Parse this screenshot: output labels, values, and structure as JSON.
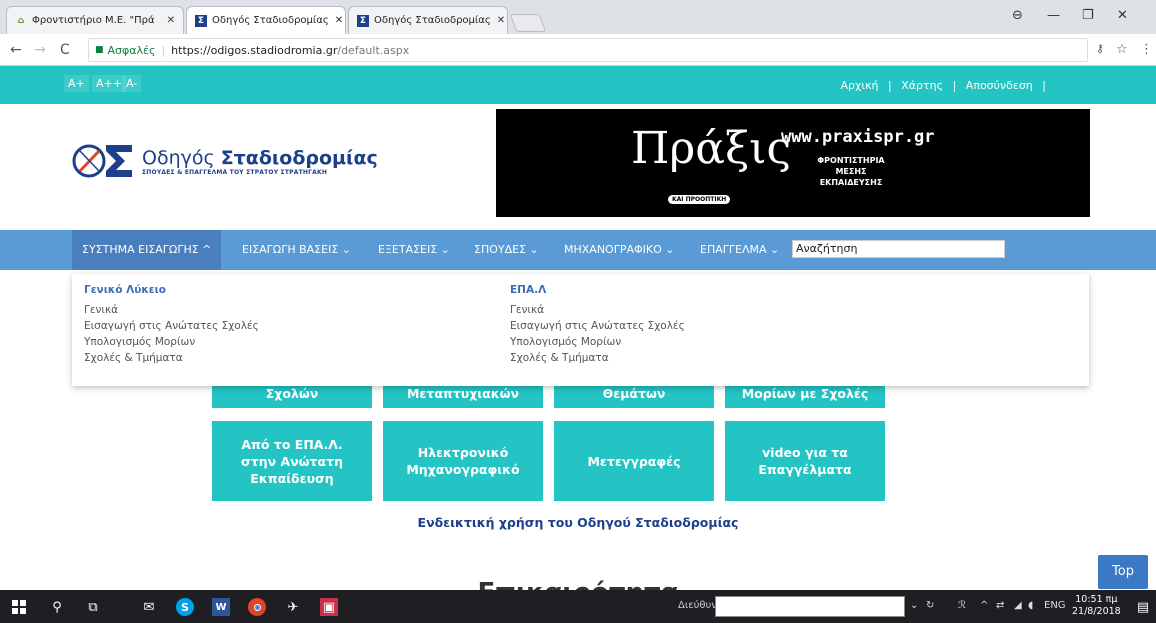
{
  "browser": {
    "tabs": [
      {
        "title": "Φροντιστήριο Μ.Ε. \"Πρά",
        "favicon": "house-icon",
        "active": false
      },
      {
        "title": "Οδηγός Σταδιοδρομίας",
        "favicon": "sigma-icon",
        "active": true
      },
      {
        "title": "Οδηγός Σταδιοδρομίας",
        "favicon": "sigma-icon",
        "active": false
      }
    ],
    "secure_label": "Ασφαλές",
    "url_host": "https://odigos.stadiodromia.gr",
    "url_path": "/default.aspx"
  },
  "site": {
    "font_sizes": [
      "A+",
      "A++",
      "A-"
    ],
    "top_links": [
      "Αρχική",
      "Χάρτης",
      "Αποσύνδεση"
    ],
    "logo_title_normal": "Οδηγός ",
    "logo_title_bold": "Σταδιοδρομίας",
    "logo_subtitle": "ΣΠΟΥΔΕΣ & ΕΠΑΓΓΕΛΜΑ ΤΟΥ ΣΤΡΑΤΟΥ ΣΤΡΑΤΗΓΑΚΗ",
    "banner": {
      "site": "www.praxispr.gr",
      "sub": [
        "ΦΡΟΝΤΙΣΤΗΡΙΑ",
        "ΜΕΣΗΣ",
        "ΕΚΠΑΙΔΕΥΣΗΣ"
      ],
      "pill": "ΚΑΙ ΠΡΟΟΠΤΙΚΗ"
    },
    "menu": [
      "ΣΥΣΤΗΜΑ ΕΙΣΑΓΩΓΗΣ ^",
      "ΕΙΣΑΓΩΓΗ ΒΑΣΕΙΣ ⌄",
      "ΕΞΕΤΑΣΕΙΣ ⌄",
      "ΣΠΟΥΔΕΣ ⌄",
      "ΜΗΧΑΝΟΓΡΑΦΙΚΟ ⌄",
      "ΕΠΑΓΓΕΛΜΑ ⌄"
    ],
    "search_value": "Αναζήτηση",
    "dropdown": {
      "col1": {
        "head": "Γενικό Λύκειο",
        "items": [
          "Γενικά",
          "Εισαγωγή στις Ανώτατες Σχολές",
          "Υπολογισμός Μορίων",
          "Σχολές & Τμήματα"
        ]
      },
      "col2": {
        "head": "ΕΠΑ.Λ",
        "items": [
          "Γενικά",
          "Εισαγωγή στις Ανώτατες Σχολές",
          "Υπολογισμός Μορίων",
          "Σχολές & Τμήματα"
        ]
      }
    },
    "tiles_row1": [
      "Σχολών",
      "Μεταπτυχιακών",
      "Θεμάτων",
      "Μορίων με Σχολές"
    ],
    "tiles_row2": [
      "Από το ΕΠΑ.Λ. στην Ανώτατη Εκπαίδευση",
      "Ηλεκτρονικό Μηχανογραφικό",
      "Μετεγγραφές",
      "video για τα Επαγγέλματα"
    ],
    "usage_link": "Ενδεικτική χρήση του Οδηγού Σταδιοδρομίας",
    "section_title": "Επικαιρότητα",
    "top_button": "Top"
  },
  "taskbar": {
    "address_label": "Διεύθυνση",
    "lang": "ENG",
    "time": "10:51 πμ",
    "date": "21/8/2018"
  },
  "colors": {
    "accent": "#23c4c3",
    "menu": "#5b9bd5",
    "brand": "#1d3f8c"
  }
}
